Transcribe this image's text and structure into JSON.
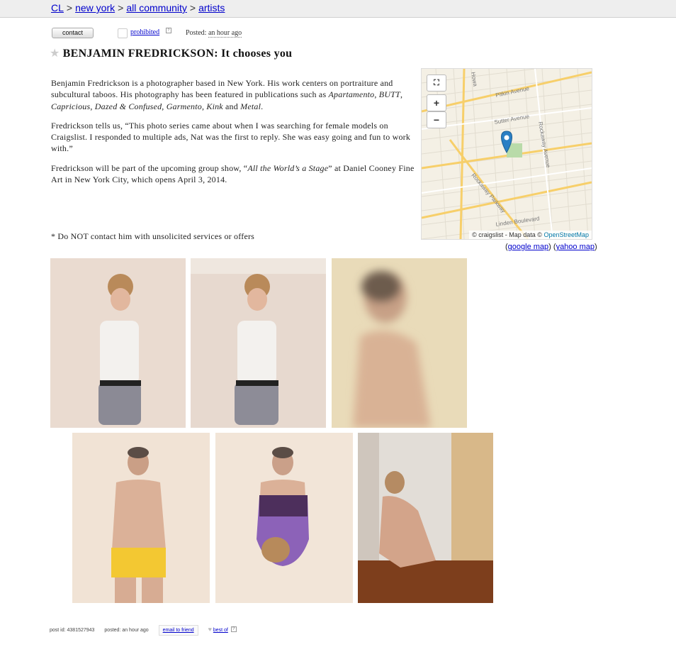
{
  "breadcrumbs": [
    {
      "label": "CL"
    },
    {
      "label": "new york"
    },
    {
      "label": "all community"
    },
    {
      "label": "artists"
    }
  ],
  "breadcrumb_sep": ">",
  "actions": {
    "contact_label": "contact",
    "prohibited_label": "prohibited",
    "posted_prefix": "Posted:",
    "posted_time": "an hour ago"
  },
  "title": "BENJAMIN FREDRICKSON: It chooses you",
  "body": {
    "p1_a": "Benjamin Fredrickson is a photographer based in New York.  His work centers on portraiture and subcultural taboos.  His photography has been featured in publications such as ",
    "p1_i1": "Apartamento",
    "p1_c1": ", ",
    "p1_i2": "BUTT",
    "p1_c2": ", ",
    "p1_i3": "Capricious",
    "p1_c3": ", ",
    "p1_i4": "Dazed & Confused",
    "p1_c4": ", ",
    "p1_i5": "Garmento",
    "p1_c5": ", ",
    "p1_i6": "Kink",
    "p1_and": " and ",
    "p1_i7": "Metal",
    "p1_end": ".",
    "p2": "Fredrickson tells us, “This photo series came about when I was searching for female models on Craigslist. I responded to multiple ads, Nat was the first to reply. She was easy going and fun to work with.”",
    "p3_a": "Fredrickson will be part of the upcoming group show, “",
    "p3_i": "All the World’s a Stage",
    "p3_b": "” at Daniel Cooney Fine Art in New York City, which opens April 3, 2014.",
    "notice": "* Do NOT contact him with unsolicited services or offers"
  },
  "map": {
    "streets": [
      "Pitkin Avenue",
      "Sutter Avenue",
      "Rockaway Avenue",
      "Rockaway Parkway",
      "Linden Boulevard",
      "Howa"
    ],
    "attribution_a": "© craigslist - Map data ©",
    "attribution_osm": "OpenStreetMap",
    "zoom_in": "+",
    "zoom_out": "−"
  },
  "map_links": {
    "open": "(",
    "google": "google map",
    "mid": ") (",
    "yahoo": "yahoo map",
    "close": ")"
  },
  "footer": {
    "post_id": "post id: 4381527943",
    "posted": "posted: an hour ago",
    "email": "email to friend",
    "best_of": "best of"
  },
  "colors": {
    "link": "#0000cc",
    "topbar": "#eeeeee",
    "map_pin": "#2a7fc4"
  }
}
